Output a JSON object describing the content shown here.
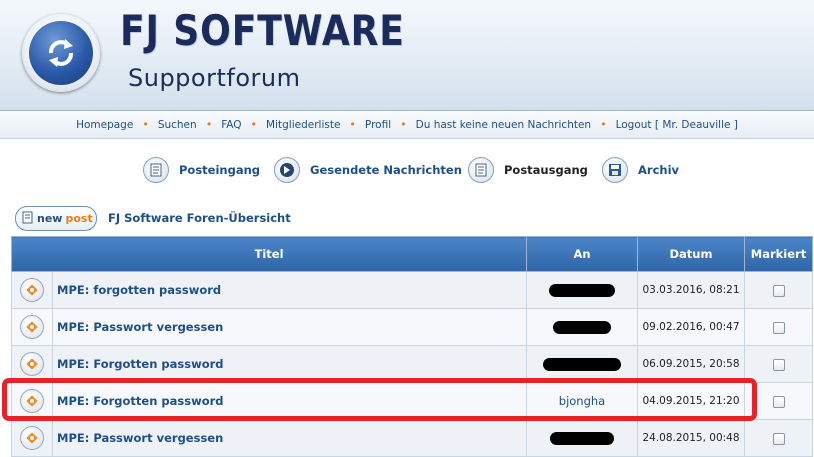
{
  "header": {
    "brand": "FJ SOFTWARE",
    "subtitle": "Supportforum"
  },
  "nav": {
    "items": [
      "Homepage",
      "Suchen",
      "FAQ",
      "Mitgliederliste",
      "Profil",
      "Du hast keine neuen Nachrichten",
      "Logout [ Mr. Deauville ]"
    ]
  },
  "pm_tabs": {
    "inbox": "Posteingang",
    "sent": "Gesendete Nachrichten",
    "outbox": "Postausgang",
    "archive": "Archiv",
    "active": "outbox"
  },
  "new_post": {
    "new": "new",
    "post": "post"
  },
  "breadcrumb": "FJ Software Foren-Übersicht",
  "table": {
    "columns": {
      "title": "Titel",
      "to": "An",
      "date": "Datum",
      "marked": "Markiert"
    },
    "rows": [
      {
        "title": "MPE: forgotten password",
        "to": "",
        "to_redacted": true,
        "date": "03.03.2016, 08:21"
      },
      {
        "title": "MPE: Passwort vergessen",
        "to": "",
        "to_redacted": true,
        "date": "09.02.2016, 00:47"
      },
      {
        "title": "MPE: Forgotten password",
        "to": "",
        "to_redacted": true,
        "date": "06.09.2015, 20:58"
      },
      {
        "title": "MPE: Forgotten password",
        "to": "bjongha",
        "to_redacted": false,
        "date": "04.09.2015, 21:20",
        "highlighted": true
      },
      {
        "title": "MPE: Passwort vergessen",
        "to": "",
        "to_redacted": true,
        "date": "24.08.2015, 00:48"
      }
    ]
  },
  "colors": {
    "link": "#1f4f86",
    "header_blue": "#3a74bb",
    "accent_orange": "#e07a1f",
    "highlight_red": "#e3222a"
  }
}
